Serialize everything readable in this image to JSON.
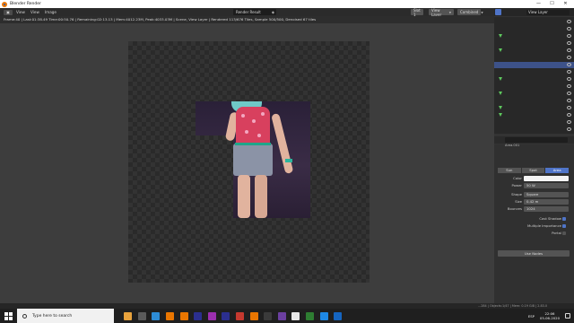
{
  "window": {
    "title": "Blender Render",
    "controls": [
      "—",
      "☐",
      "✕"
    ]
  },
  "menubar": {
    "editor_icon": "image-editor-icon",
    "items": [
      "View",
      "View",
      "Image"
    ],
    "image_name": "Render Result",
    "slot": "Slot 1",
    "view_layer": "View Layer",
    "pass": "Combined"
  },
  "status_line": "Frame:40 | Last:01:38.49 Time:00:50.76 | Remaining:02:13.13 | Mem:4012.23M, Peak:4033.03M | Scene, View Layer | Rendered 113/676 Tiles, Sample 500/500, Denoised 67 tiles",
  "right_panel": {
    "top_field": "View Layer",
    "object_label": "Area.001",
    "tabs": [
      "Sun",
      "Spot",
      "Area"
    ],
    "active_tab": "Area",
    "rows": [
      {
        "label": "Color",
        "value": ""
      },
      {
        "label": "Power",
        "value": "50 W"
      },
      {
        "label": "Shape",
        "value": "Square"
      },
      {
        "label": "Size",
        "value": "0.42 m"
      },
      {
        "label": "Bounces",
        "value": "1024"
      }
    ],
    "checks": [
      "Cast Shadow",
      "Multiple Importance",
      "Portal"
    ],
    "use_nodes": "Use Nodes"
  },
  "bottom_status": "...284 | Objects:1/47 | Mem: 0.19 GiB | 2.83.0",
  "taskbar": {
    "search_placeholder": "Type here to search",
    "app_colors": [
      "#e8a23c",
      "#5b5b5b",
      "#2d8cd6",
      "#ea7600",
      "#ea7600",
      "#2b2f8f",
      "#9b2fae",
      "#2b2f8f",
      "#c5392f",
      "#ea7600",
      "#3a3a3a",
      "#6b3fa0",
      "#e8e8e8",
      "#2e7d32",
      "#1e88e5",
      "#1565c0"
    ],
    "language": "ESP",
    "time": "22:06",
    "date": "05-06-2020"
  },
  "colors": {
    "accent": "#4f74c8",
    "outliner_green": "#5ec85e"
  }
}
